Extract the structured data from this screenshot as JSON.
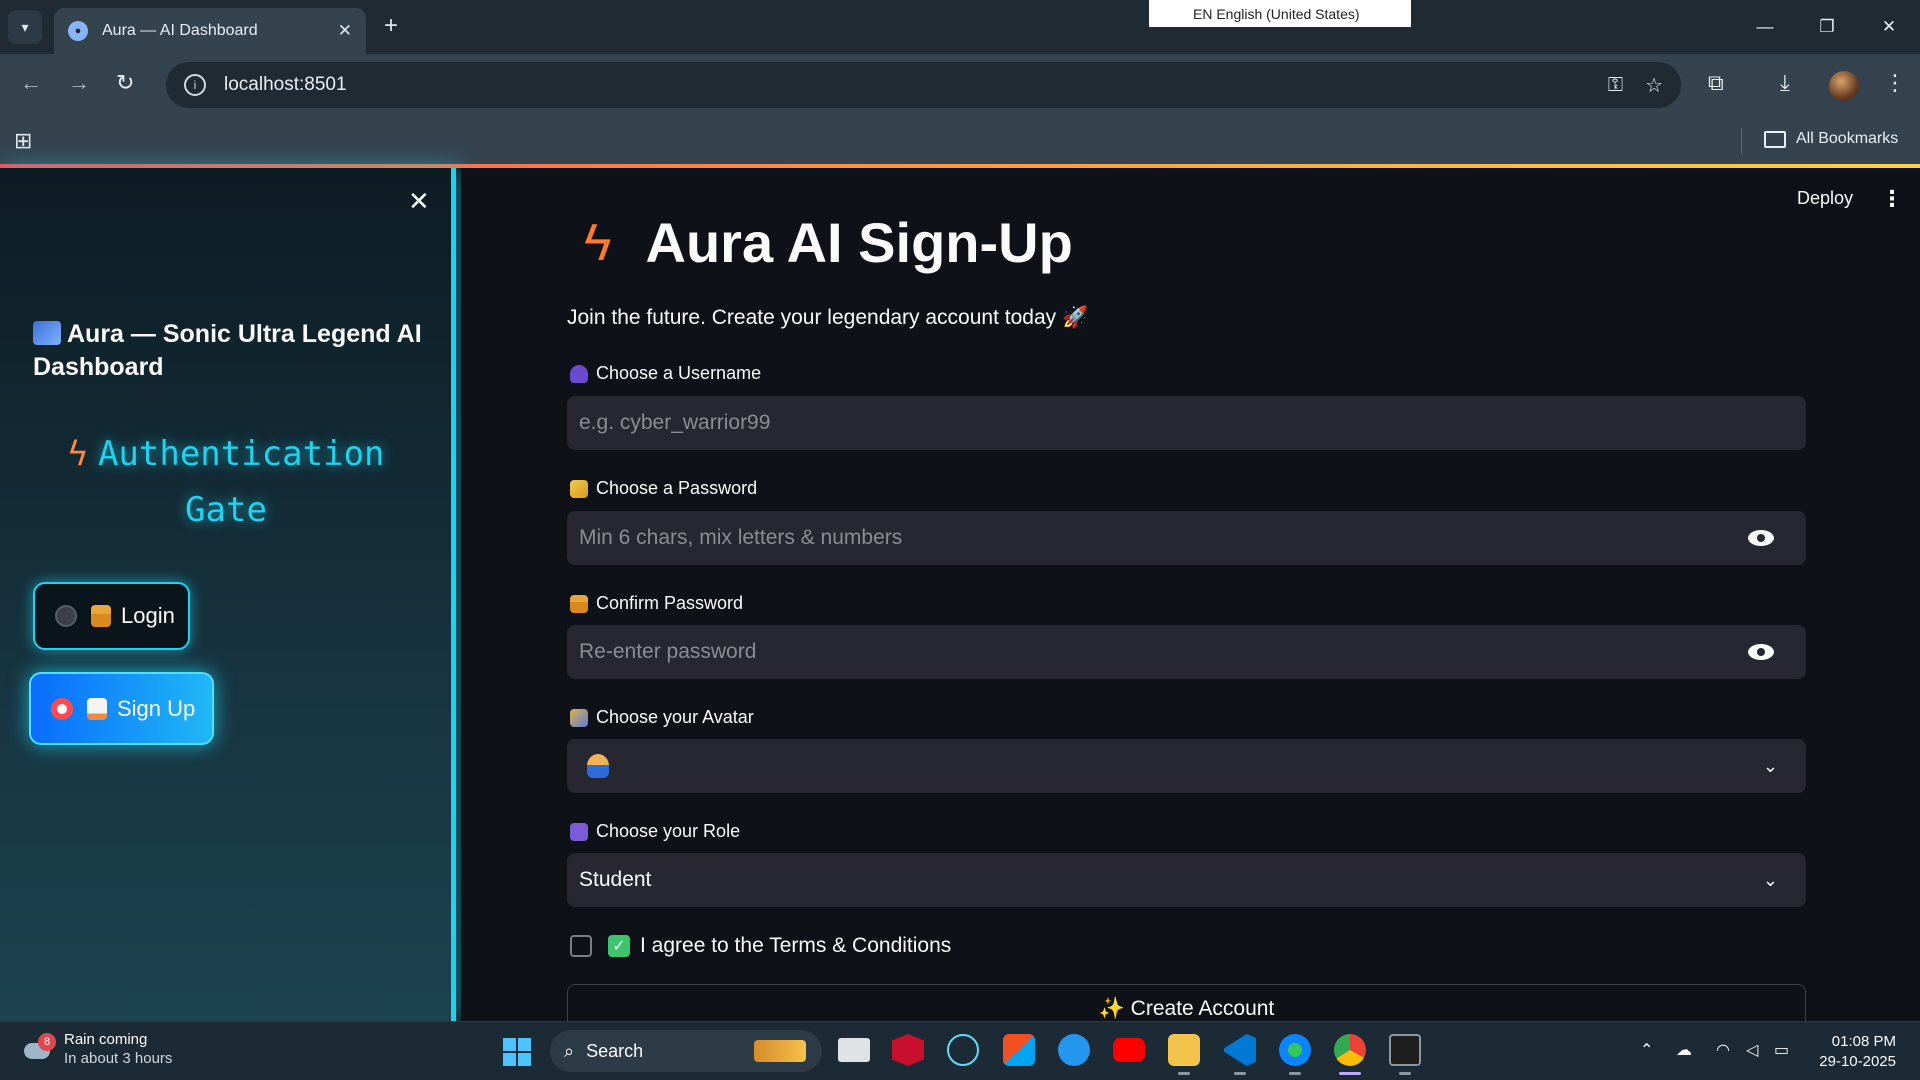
{
  "browser": {
    "tab_title": "Aura — AI Dashboard",
    "new_tab": "+",
    "language_indicator": "EN English (United States)",
    "url": "localhost:8501",
    "bookmarks_label": "All Bookmarks"
  },
  "header": {
    "deploy_label": "Deploy",
    "menu_icon": "⋮"
  },
  "sidebar": {
    "close_icon": "✕",
    "app_title": "Aura — Sonic Ultra Legend AI Dashboard",
    "section_title": "Authentication Gate",
    "section_icon": "lightning-icon",
    "auth_options": [
      {
        "label": "Login",
        "icon": "lock-icon",
        "selected": false
      },
      {
        "label": "Sign Up",
        "icon": "memo-icon",
        "selected": true
      }
    ]
  },
  "main": {
    "title": "Aura AI Sign-Up",
    "title_icon": "lightning-icon",
    "subtitle": "Join the future. Create your legendary account today 🚀",
    "fields": {
      "username": {
        "label": "Choose a Username",
        "placeholder": "e.g. cyber_warrior99",
        "value": ""
      },
      "password": {
        "label": "Choose a Password",
        "placeholder": "Min 6 chars, mix letters & numbers",
        "value": ""
      },
      "confirm_password": {
        "label": "Confirm Password",
        "placeholder": "Re-enter password",
        "value": ""
      },
      "avatar": {
        "label": "Choose your Avatar",
        "selected": "person-icon"
      },
      "role": {
        "label": "Choose your Role",
        "selected": "Student"
      }
    },
    "terms": {
      "label": "I agree to the Terms & Conditions",
      "checked": false
    },
    "submit_label": "✨ Create Account"
  },
  "taskbar": {
    "weather_badge": "8",
    "weather_title": "Rain coming",
    "weather_sub": "In about 3 hours",
    "search_label": "Search",
    "time": "01:08 PM",
    "date": "29-10-2025"
  },
  "colors": {
    "accent_cyan": "#1fd3f0",
    "primary_red": "#ff4b4b",
    "app_background": "#0e1117",
    "input_background": "#262730"
  }
}
